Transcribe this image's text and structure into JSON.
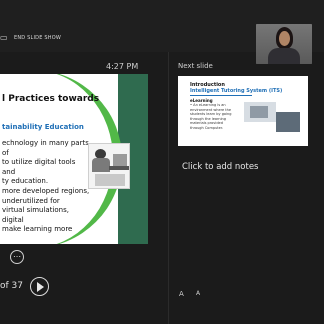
{
  "toolbar": {
    "end_slide_show": "END SLIDE SHOW"
  },
  "presenter": {
    "time": "4:27 PM",
    "slide_count": "of 37",
    "more_glyph": "⋯"
  },
  "current_slide": {
    "title": "l Practices towards",
    "subtitle": "tainability Education",
    "body_lines": [
      "echnology in many parts of",
      "to utilize digital tools and",
      "ty education.",
      "more developed regions,",
      "underutilized for",
      "virtual simulations, digital",
      "make learning more"
    ]
  },
  "next_slide": {
    "label": "Next slide",
    "title_line1": "Introduction",
    "title_line2": "Intelligent Tutoring System (ITS)",
    "heading": "eLearning",
    "body": "• An eLearning is an environment where the students learn by going through the learning materials provided through Computer."
  },
  "notes": {
    "placeholder": "Click to add notes"
  },
  "font_controls": {
    "increase": "A",
    "decrease": "A"
  },
  "colors": {
    "background": "#1b1b1b",
    "slide_green": "#52b848",
    "slide_dark_green": "#2f6b4f",
    "accent_blue": "#1f6fb6"
  }
}
